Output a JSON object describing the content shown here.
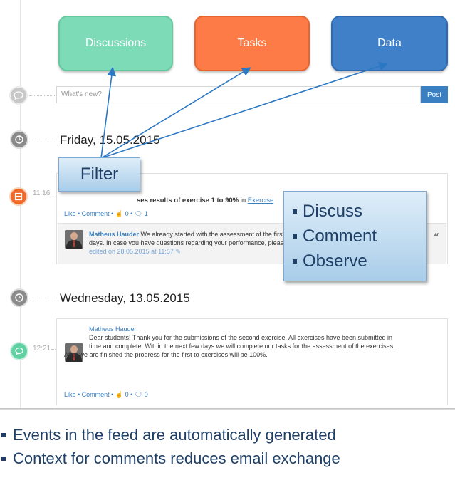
{
  "tiles": {
    "discussions": "Discussions",
    "tasks": "Tasks",
    "data": "Data"
  },
  "composer": {
    "placeholder": "What's new?",
    "post_label": "Post"
  },
  "days": {
    "first": "Friday, 15.05.2015",
    "second": "Wednesday, 13.05.2015"
  },
  "event1": {
    "time": "11:16",
    "title_prefix": "ses results of exercise 1 to 90%",
    "title_in": " in ",
    "title_link": "Exercise",
    "actions": "Like • Comment • ",
    "likes": "0",
    "comments": "1",
    "comment": {
      "author": "Matheus Hauder",
      "text_a": " We already started with the assessment of the first two ",
      "text_b": "w",
      "text_c": "days. In case you have questions regarding your performance, please conta",
      "edited": "edited on 28.05.2015 at 11:57"
    }
  },
  "event2": {
    "time": "12:21",
    "author": "Matheus Hauder",
    "text_1": "Dear students! Thank you for the submissions of the second exercise. All exercises have been submitted in",
    "text_2": "time and complete. Within the next few days we will complete our tasks for the assessment of the exercises.",
    "text_3": "After we are finished the progress for the first to exercises will be 100%.",
    "actions": "Like • Comment • ",
    "likes": "0",
    "comments": "0"
  },
  "callouts": {
    "filter": "Filter",
    "bullets": [
      "Discuss",
      "Comment",
      "Observe"
    ]
  },
  "captions": [
    "Events in the feed are automatically generated",
    "Context for comments reduces email exchange"
  ],
  "icons": {
    "composer": "speech-bubble-icon",
    "day": "clock-icon",
    "event1": "server-icon",
    "event2": "chat-icon"
  },
  "colors": {
    "discussions": "#7ddcb7",
    "tasks": "#fd7b46",
    "data": "#3f80c8",
    "callout_text": "#1f3f66"
  }
}
